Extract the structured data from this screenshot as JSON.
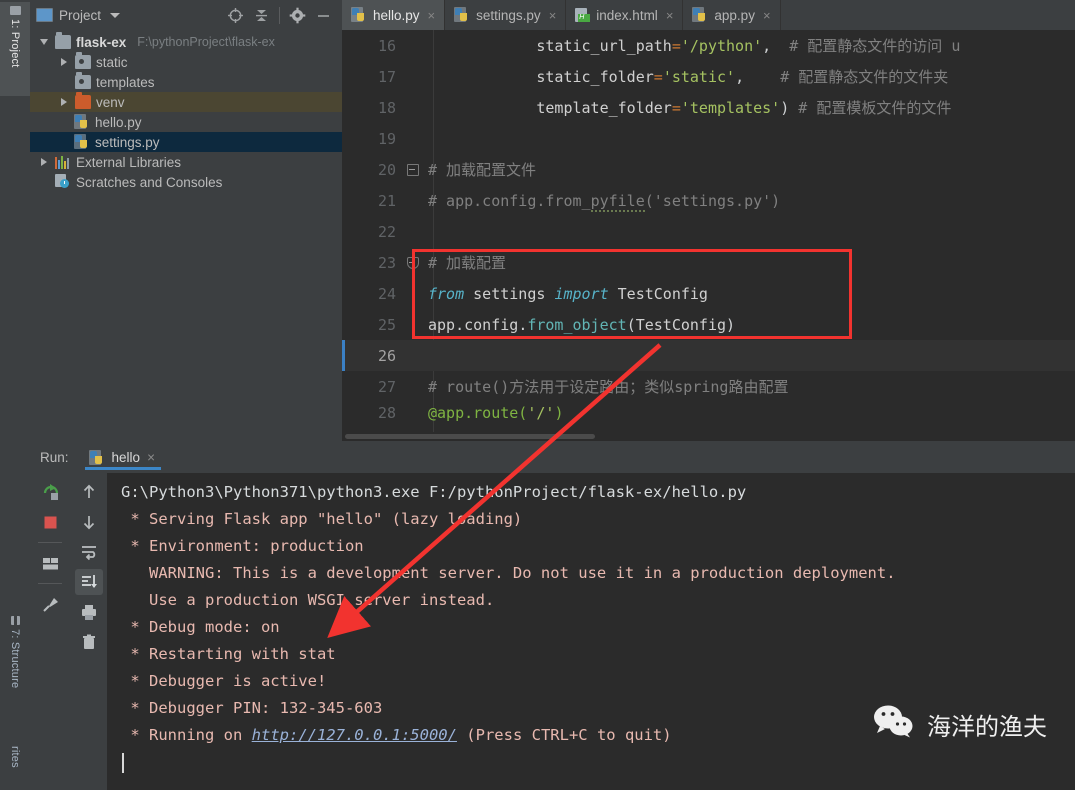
{
  "left_strip": {
    "tabs": [
      {
        "label": "1: Project",
        "icon": "folder-icon",
        "active": true
      },
      {
        "label": "7: Structure",
        "icon": "structure-icon",
        "active": false
      },
      {
        "label": "rites",
        "icon": "favorites-icon",
        "active": false
      }
    ]
  },
  "project_panel": {
    "title": "Project",
    "toolbar_icons": [
      "locate-target-icon",
      "collapse-all-icon",
      "settings-gear-icon",
      "hide-minimize-icon"
    ],
    "tree": [
      {
        "label": "flask-ex",
        "path": "F:\\pythonProject\\flask-ex",
        "icon": "folder-icon",
        "twisty": "down",
        "indent": 0,
        "state": "normal",
        "bold": true
      },
      {
        "label": "static",
        "path": "",
        "icon": "folder-dot-icon",
        "twisty": "right",
        "indent": 1,
        "state": "normal",
        "bold": false
      },
      {
        "label": "templates",
        "path": "",
        "icon": "folder-dot-icon",
        "twisty": "none",
        "indent": 1,
        "state": "normal",
        "bold": false
      },
      {
        "label": "venv",
        "path": "",
        "icon": "folder-orange-icon",
        "twisty": "right",
        "indent": 1,
        "state": "hover",
        "bold": false
      },
      {
        "label": "hello.py",
        "path": "",
        "icon": "python-file-icon",
        "twisty": "none",
        "indent": 2,
        "state": "normal",
        "bold": false
      },
      {
        "label": "settings.py",
        "path": "",
        "icon": "python-file-icon",
        "twisty": "none",
        "indent": 2,
        "state": "selected",
        "bold": false
      },
      {
        "label": "External Libraries",
        "path": "",
        "icon": "libraries-icon",
        "twisty": "right",
        "indent": 0,
        "state": "normal",
        "bold": false
      },
      {
        "label": "Scratches and Consoles",
        "path": "",
        "icon": "scratches-icon",
        "twisty": "none",
        "indent": 0,
        "state": "normal",
        "bold": false
      }
    ]
  },
  "editor_tabs": [
    {
      "label": "hello.py",
      "icon": "python-file-icon",
      "active": true,
      "close": "×"
    },
    {
      "label": "settings.py",
      "icon": "python-file-icon",
      "active": false,
      "close": "×"
    },
    {
      "label": "index.html",
      "icon": "html-file-icon",
      "active": false,
      "close": "×"
    },
    {
      "label": "app.py",
      "icon": "python-file-icon",
      "active": false,
      "close": "×"
    }
  ],
  "editor": {
    "current_line": 26,
    "lines": [
      {
        "num": "16",
        "text": "            static_url_path='/python',  # 配置静态文件的访问 u"
      },
      {
        "num": "17",
        "text": "            static_folder='static',     # 配置静态文件的文件夹"
      },
      {
        "num": "18",
        "text": "            template_folder='templates') # 配置模板文件的文件"
      },
      {
        "num": "19",
        "text": ""
      },
      {
        "num": "20",
        "text": "# 加载配置文件"
      },
      {
        "num": "21",
        "text": "# app.config.from_pyfile('settings.py')"
      },
      {
        "num": "22",
        "text": ""
      },
      {
        "num": "23",
        "text": "# 加载配置"
      },
      {
        "num": "24",
        "text": "from settings import TestConfig"
      },
      {
        "num": "25",
        "text": "app.config.from_object(TestConfig)"
      },
      {
        "num": "26",
        "text": ""
      },
      {
        "num": "27",
        "text": "# route()方法用于设定路由；类似spring路由配置"
      },
      {
        "num": "28",
        "text": "@app.route('/')"
      }
    ],
    "highlight_box": {
      "color": "#f2332f",
      "lines": "23-25"
    }
  },
  "run_panel": {
    "label": "Run:",
    "tab": {
      "label": "hello",
      "icon": "python-file-icon",
      "close": "×"
    },
    "toolbar": [
      {
        "name": "rerun-icon",
        "tooltip": "Rerun"
      },
      {
        "name": "stop-icon",
        "tooltip": "Stop"
      },
      {
        "name": "restore-layout-icon",
        "tooltip": "Restore Layout"
      },
      {
        "name": "pin-tab-icon",
        "tooltip": "Pin Tab"
      }
    ],
    "toolbar2": [
      {
        "name": "arrow-up-icon",
        "tooltip": "Up the stack trace"
      },
      {
        "name": "arrow-down-icon",
        "tooltip": "Down the stack trace"
      },
      {
        "name": "soft-wrap-icon",
        "tooltip": "Soft-Wrap"
      },
      {
        "name": "scroll-to-end-icon",
        "tooltip": "Scroll to the end",
        "active": true
      },
      {
        "name": "print-icon",
        "tooltip": "Print"
      },
      {
        "name": "clear-all-icon",
        "tooltip": "Clear All"
      }
    ],
    "console_lines": [
      {
        "style": "white",
        "text": "G:\\Python3\\Python371\\python3.exe F:/pythonProject/flask-ex/hello.py"
      },
      {
        "style": "err",
        "text": " * Serving Flask app \"hello\" (lazy loading)"
      },
      {
        "style": "err",
        "text": " * Environment: production"
      },
      {
        "style": "err",
        "text": "   WARNING: This is a development server. Do not use it in a production deployment."
      },
      {
        "style": "err",
        "text": "   Use a production WSGI server instead."
      },
      {
        "style": "err",
        "text": " * Debug mode: on"
      },
      {
        "style": "err",
        "text": " * Restarting with stat"
      },
      {
        "style": "err",
        "text": " * Debugger is active!"
      },
      {
        "style": "err",
        "text": " * Debugger PIN: 132-345-603"
      },
      {
        "style": "link",
        "prefix": " * Running on ",
        "link": "http://127.0.0.1:5000/",
        "suffix": " (Press CTRL+C to quit)"
      }
    ]
  },
  "watermark": {
    "text": "海洋的渔夫",
    "icon": "wechat-icon"
  },
  "colors": {
    "accent_red": "#f2332f",
    "selection_blue": "#0d293e",
    "tab_underline": "#3c87c8",
    "editor_bg": "#2b2b2b",
    "panel_bg": "#3c3f41"
  }
}
